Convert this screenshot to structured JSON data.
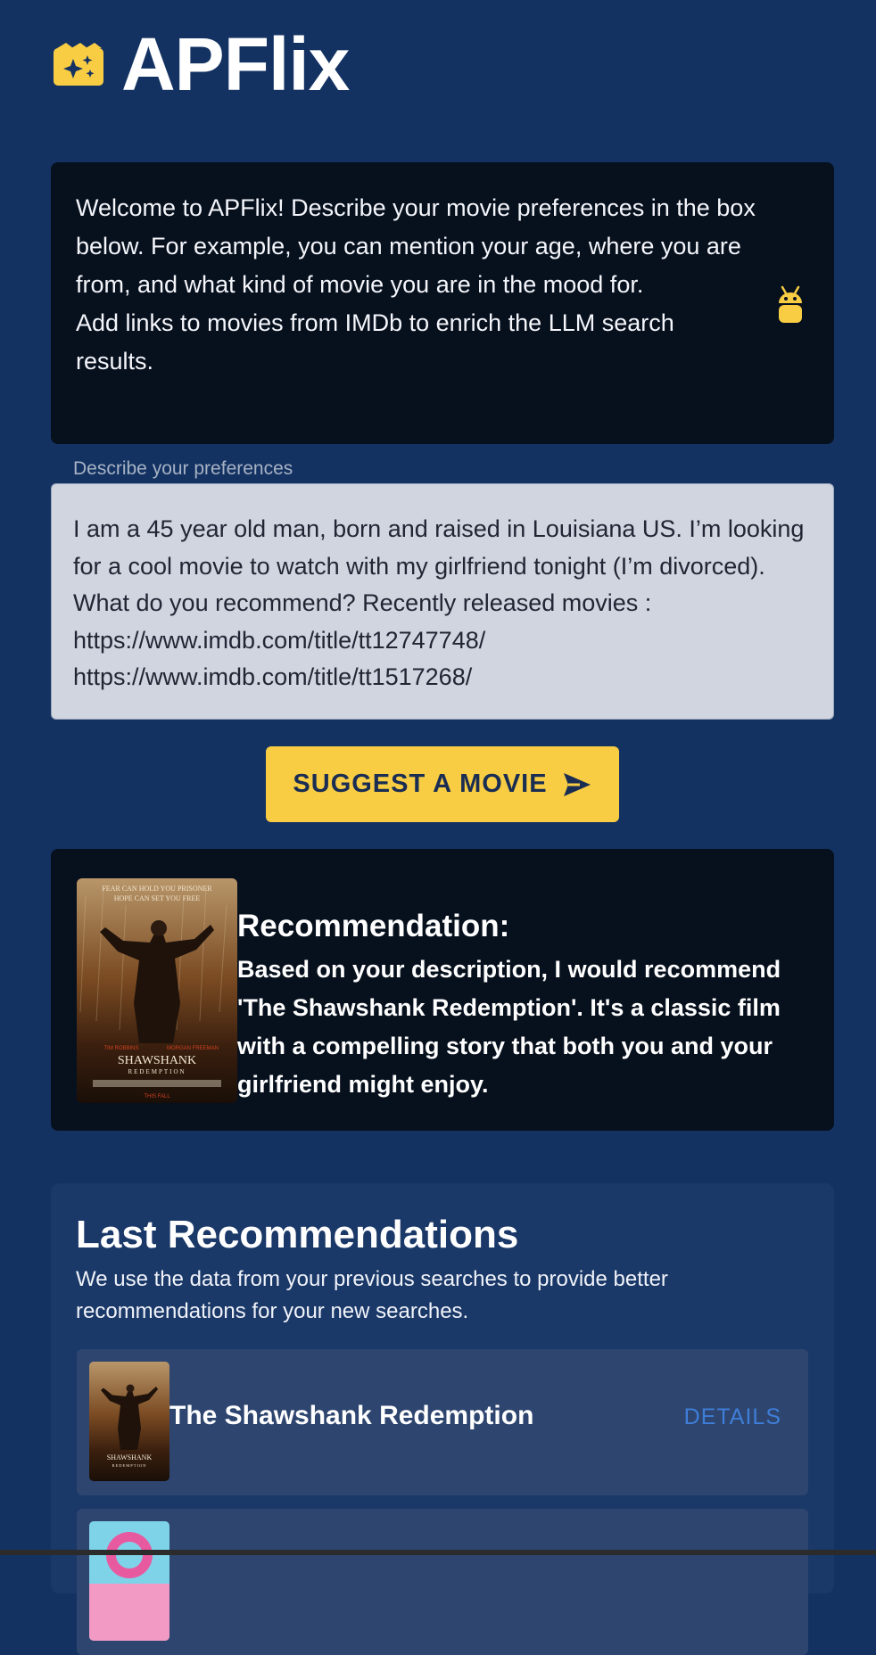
{
  "header": {
    "title": "APFlix",
    "icon": "movie-sparkle-icon",
    "accent_color": "#f8cd44"
  },
  "welcome": {
    "line1": "Welcome to APFlix! Describe your movie preferences in the box below. For example, you can mention your age, where you are from, and what kind of movie you are in the mood for.",
    "line2": "Add links to movies from IMDb to enrich the LLM search results.",
    "icon": "android-bot-icon"
  },
  "preferences": {
    "label": "Describe your preferences",
    "value": "I am a 45 year old man, born and raised in Louisiana US. I’m looking for a cool movie to watch with my girlfriend tonight (I’m divorced). What do you recommend? Recently released movies : https://www.imdb.com/title/tt12747748/ https://www.imdb.com/title/tt1517268/"
  },
  "suggest_button": {
    "label": "SUGGEST A MOVIE",
    "icon": "send-icon"
  },
  "recommendation": {
    "heading": "Recommendation:",
    "body": "Based on your description, I would recommend 'The Shawshank Redemption'. It's a classic film with a compelling story that both you and your girlfriend might enjoy.",
    "poster_alt": "The Shawshank Redemption poster"
  },
  "last_recommendations": {
    "title": "Last Recommendations",
    "subtitle": "We use the data from your previous searches to provide better recommendations for your new searches.",
    "items": [
      {
        "title": "The Shawshank Redemption",
        "details_label": "DETAILS"
      }
    ]
  }
}
